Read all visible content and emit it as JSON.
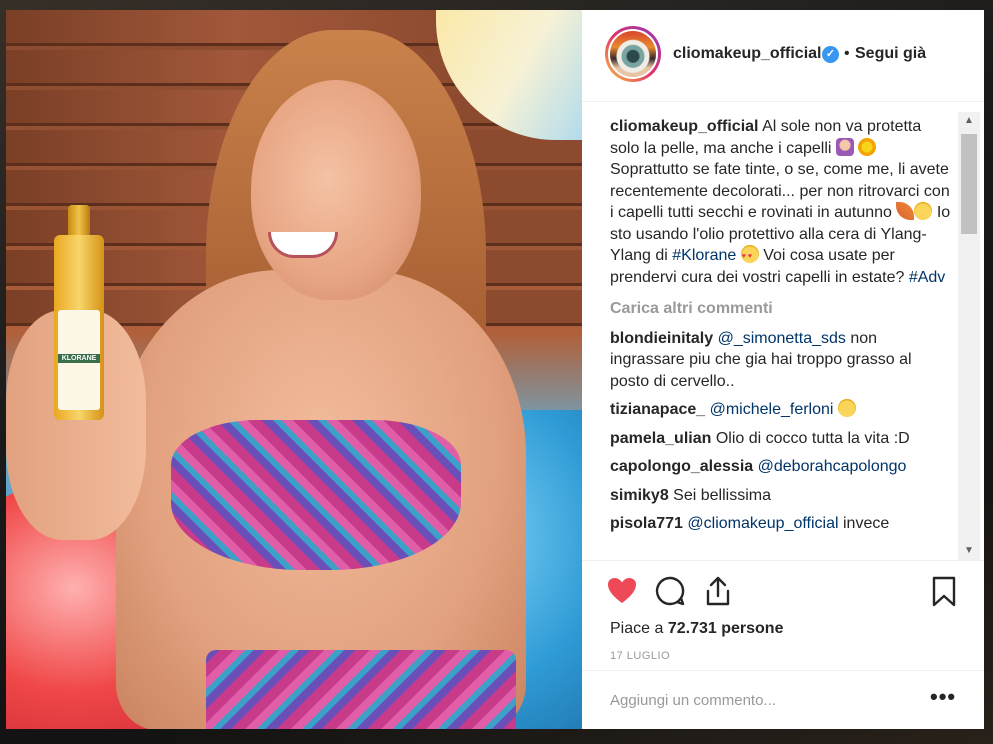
{
  "post": {
    "username": "cliomakeup_official",
    "follow_status": "Segui già",
    "separator": "•",
    "verified_icon": "✓"
  },
  "caption": {
    "user": "cliomakeup_official",
    "text_1": "Al sole non va protetta solo la pelle, ma anche i capelli",
    "text_2": "Soprattutto se fate tinte, o se, come me, li avete recentemente decolorati... per non ritrovarci con i capelli tutti secchi e rovinati in autunno",
    "text_3": "Io sto usando l'olio protettivo alla cera di Ylang-Ylang di",
    "hashtag_1": "#Klorane",
    "text_4": "Voi cosa usate per prendervi cura dei vostri capelli in estate?",
    "hashtag_2": "#Adv"
  },
  "load_more": "Carica altri commenti",
  "comments": [
    {
      "user": "blondieinitaly",
      "mention": "@_simonetta_sds",
      "text": "non ingrassare piu che gia hai troppo grasso al posto di cervello.."
    },
    {
      "user": "tizianapace_",
      "mention": "@michele_ferloni",
      "text": ""
    },
    {
      "user": "pamela_ulian",
      "mention": "",
      "text": "Olio di cocco tutta la vita :D"
    },
    {
      "user": "capolongo_alessia",
      "mention": "@deborahcapolongo",
      "text": ""
    },
    {
      "user": "simiky8",
      "mention": "",
      "text": "Sei bellissima"
    },
    {
      "user": "pisola771",
      "mention": "@cliomakeup_official",
      "text": "invece"
    }
  ],
  "likes": {
    "prefix": "Piace a",
    "count": "72.731",
    "suffix": "persone"
  },
  "date": "17 LUGLIO",
  "add_comment": {
    "placeholder": "Aggiungi un commento...",
    "more_label": "•••"
  },
  "bottle": {
    "brand": "KLORANE"
  },
  "colors": {
    "heart": "#ed4956",
    "link": "#003569",
    "muted": "#999999",
    "text": "#262626"
  },
  "icons": [
    "heart-icon",
    "comment-icon",
    "share-icon",
    "bookmark-icon",
    "verified-icon"
  ]
}
